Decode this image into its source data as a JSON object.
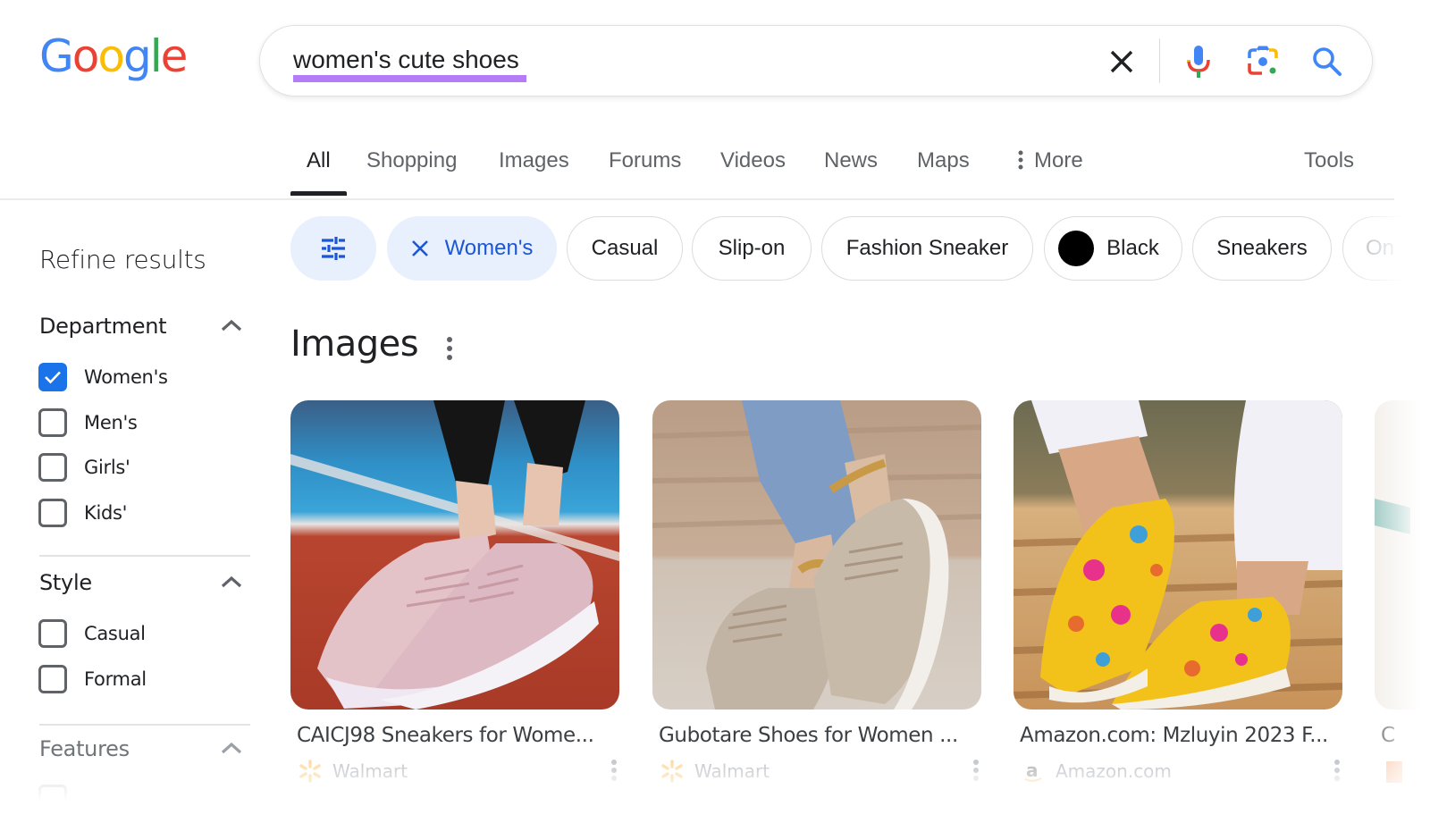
{
  "logo": {
    "letters": [
      "G",
      "o",
      "o",
      "g",
      "l",
      "e"
    ],
    "colors": [
      "#4285f4",
      "#ea4335",
      "#fbbc05",
      "#4285f4",
      "#34a853",
      "#ea4335"
    ]
  },
  "search": {
    "query": "women's cute shoes",
    "highlight_color": "#b57cf7",
    "icons": [
      "clear-icon",
      "microphone-icon",
      "google-lens-icon",
      "search-icon"
    ]
  },
  "tabs": {
    "items": [
      {
        "label": "All",
        "active": true
      },
      {
        "label": "Shopping"
      },
      {
        "label": "Images"
      },
      {
        "label": "Forums"
      },
      {
        "label": "Videos"
      },
      {
        "label": "News"
      },
      {
        "label": "Maps"
      },
      {
        "label": "More"
      }
    ],
    "tools": "Tools"
  },
  "chips": [
    {
      "type": "filter-icon",
      "label": ""
    },
    {
      "label": "Women's",
      "selected": true
    },
    {
      "label": "Casual"
    },
    {
      "label": "Slip-on"
    },
    {
      "label": "Fashion Sneaker"
    },
    {
      "label": "Black",
      "swatch": "#000000"
    },
    {
      "label": "Sneakers"
    },
    {
      "label": "On"
    }
  ],
  "sidebar": {
    "title": "Refine results",
    "sections": [
      {
        "heading": "Department",
        "options": [
          {
            "label": "Women's",
            "checked": true
          },
          {
            "label": "Men's",
            "checked": false
          },
          {
            "label": "Girls'",
            "checked": false
          },
          {
            "label": "Kids'",
            "checked": false
          }
        ]
      },
      {
        "heading": "Style",
        "options": [
          {
            "label": "Casual",
            "checked": false
          },
          {
            "label": "Formal",
            "checked": false
          }
        ]
      },
      {
        "heading": "Features",
        "options": []
      }
    ]
  },
  "images_section": {
    "title": "Images",
    "cards": [
      {
        "title": "CAICJ98 Sneakers for Wome...",
        "source": "Walmart",
        "description": "pink knit sneakers on red running track"
      },
      {
        "title": "Gubotare Shoes for Women ...",
        "source": "Walmart",
        "description": "beige knit sneakers with gold anklets"
      },
      {
        "title": "Amazon.com: Mzluyin 2023 F...",
        "source": "Amazon.com",
        "description": "yellow floral Easter print slip-on canvas shoes"
      },
      {
        "title": "C",
        "source": "",
        "description": "partially visible result"
      }
    ]
  }
}
